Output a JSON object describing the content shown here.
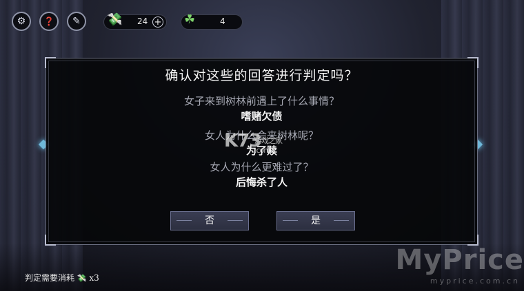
{
  "hud": {
    "money_value": "24",
    "clover_value": "4",
    "icons": [
      "settings-gear-icon",
      "journal-icon",
      "quill-icon",
      "money-icon",
      "plus-icon",
      "clover-icon"
    ]
  },
  "dialog": {
    "title": "确认对这些的回答进行判定吗？",
    "questions": [
      {
        "q": "女子来到树林前遇上了什么事情？",
        "a": "嗜赌欠债"
      },
      {
        "q": "女人为什么会来树林呢？",
        "a": "为了赎"
      },
      {
        "q": "女人为什么更难过了？",
        "a": "后悔杀了人"
      }
    ],
    "no_label": "否",
    "yes_label": "是"
  },
  "footer": {
    "cost_text": "判定需要消耗",
    "cost_count": "x3"
  },
  "watermarks": {
    "k73": "K73",
    "k73_sub": "游戏之家",
    "k73_domain": ".com",
    "brand": "MyPrice",
    "brand_url": "myprice.com.cn"
  },
  "colors": {
    "accent_gem": "#6fb8d9",
    "dialog_bg": "#06070a",
    "button_bg": "#353849"
  }
}
